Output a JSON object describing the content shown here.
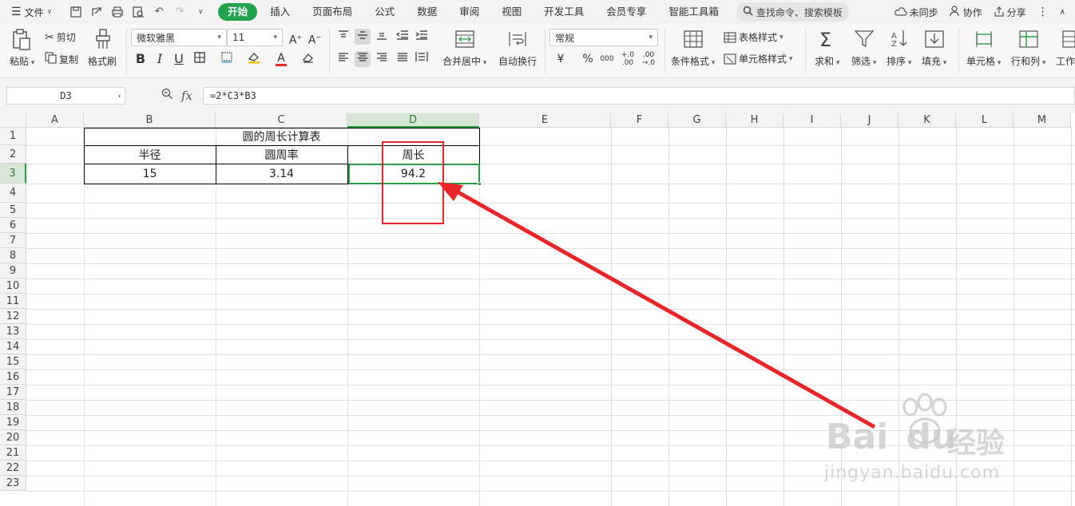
{
  "menubar": {
    "file_label": "文件",
    "tabs": [
      {
        "label": "开始",
        "active": true
      },
      {
        "label": "插入"
      },
      {
        "label": "页面布局"
      },
      {
        "label": "公式"
      },
      {
        "label": "数据"
      },
      {
        "label": "审阅"
      },
      {
        "label": "视图"
      },
      {
        "label": "开发工具"
      },
      {
        "label": "会员专享"
      },
      {
        "label": "智能工具箱"
      }
    ],
    "search_label": "查找命令、搜索模板",
    "sync_label": "未同步",
    "collab_label": "协作",
    "share_label": "分享"
  },
  "ribbon": {
    "paste": "粘贴",
    "cut": "剪切",
    "copy": "复制",
    "format_painter": "格式刷",
    "font_name": "微软雅黑",
    "font_size": "11",
    "merge_center": "合并居中",
    "wrap_text": "自动换行",
    "number_format": "常规",
    "conditional_format": "条件格式",
    "table_style": "表格样式",
    "cell_style": "单元格样式",
    "sum": "求和",
    "filter": "筛选",
    "sort": "排序",
    "fill": "填充",
    "cell": "单元格",
    "row_col": "行和列",
    "worksheet": "工作"
  },
  "formula_bar": {
    "cell_ref": "D3",
    "formula": "=2*C3*B3"
  },
  "columns": [
    "A",
    "B",
    "C",
    "D",
    "E",
    "F",
    "G",
    "H",
    "I",
    "J",
    "K",
    "L",
    "M"
  ],
  "rows": [
    "1",
    "2",
    "3",
    "4",
    "5",
    "6",
    "7",
    "8",
    "9",
    "10",
    "11",
    "12",
    "13",
    "14",
    "15",
    "16",
    "17",
    "18",
    "19",
    "20",
    "21",
    "22",
    "23"
  ],
  "sheet": {
    "title": "圆的周长计算表",
    "headers": [
      "半径",
      "圆周率",
      "周长"
    ],
    "values": [
      "15",
      "3.14",
      "94.2"
    ]
  },
  "annotation": {
    "box_color": "#e8262a",
    "arrow_color": "#e8262a"
  },
  "watermark": {
    "brand": "Bai",
    "brand2": "du",
    "cn": "经验",
    "url": "jingyan.baidu.com"
  }
}
